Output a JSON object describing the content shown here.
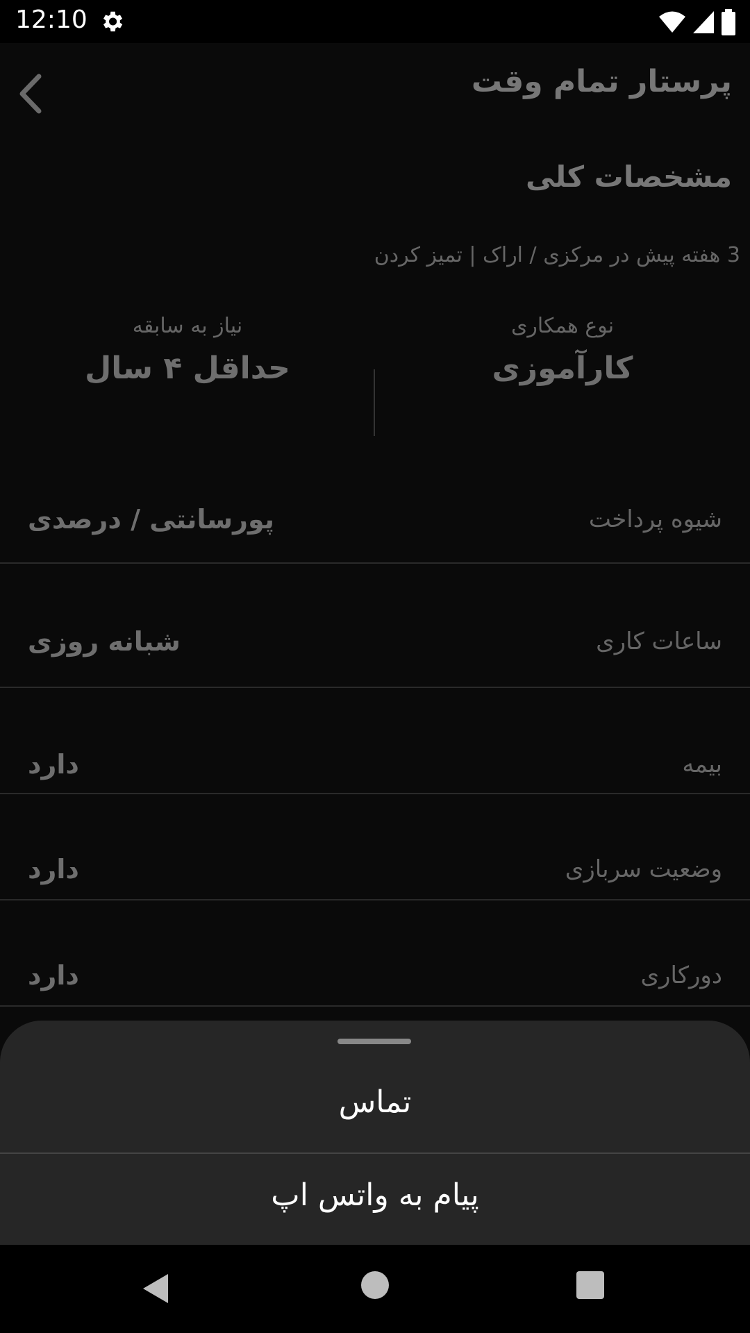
{
  "status_bar": {
    "time": "12:10",
    "icons": [
      "settings-icon",
      "wifi-icon",
      "signal-icon",
      "battery-icon"
    ]
  },
  "header": {
    "title": "پرستار تمام وقت",
    "back_icon": "chevron-left-icon"
  },
  "section": {
    "title": "مشخصات کلی",
    "meta": "3 هفته پیش در مرکزی / اراک | تمیز کردن"
  },
  "summary": {
    "cooperation_type": {
      "label": "نوع همکاری",
      "value": "کارآموزی"
    },
    "experience": {
      "label": "نیاز به سابقه",
      "value": "حداقل ۴ سال"
    }
  },
  "details": [
    {
      "label": "شیوه پرداخت",
      "value": "پورسانتی / درصدی"
    },
    {
      "label": "ساعات کاری",
      "value": "شبانه روزی"
    },
    {
      "label": "بیمه",
      "value": "دارد"
    },
    {
      "label": "وضعیت سربازی",
      "value": "دارد"
    },
    {
      "label": "دورکاری",
      "value": "دارد"
    }
  ],
  "bottom_sheet": {
    "options": [
      {
        "label": "تماس"
      },
      {
        "label": "پیام به واتس اپ"
      }
    ]
  },
  "colors": {
    "background": "#0a0a0a",
    "sheet": "#262626",
    "muted_text": "#6e6e6e",
    "sheet_text": "#ffffff"
  }
}
